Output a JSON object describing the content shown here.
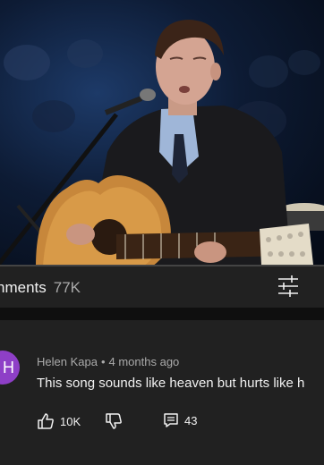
{
  "video": {
    "progress_fraction": 0.0
  },
  "comments": {
    "title": "nments",
    "count": "77K",
    "sort_icon": "sort-filter-icon"
  },
  "comment": {
    "avatar_letter": "H",
    "avatar_color": "#8e3fc7",
    "author": "Helen Kapa",
    "separator": "•",
    "time": "4 months ago",
    "text": "This song sounds like heaven but hurts like h",
    "likes": "10K",
    "replies": "43",
    "like_icon": "thumbs-up-icon",
    "dislike_icon": "thumbs-down-icon",
    "reply_icon": "reply-icon"
  }
}
